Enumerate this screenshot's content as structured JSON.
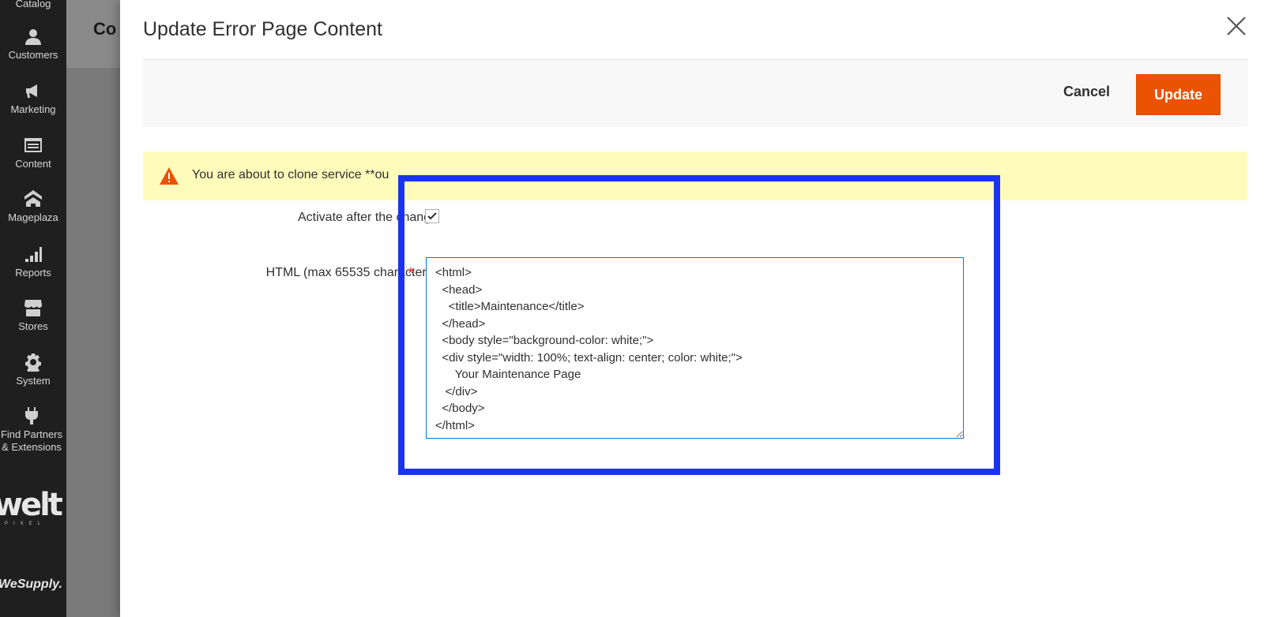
{
  "sidebar": {
    "items": [
      {
        "label": "Catalog",
        "icon": "catalog-icon"
      },
      {
        "label": "Customers",
        "icon": "customers-icon"
      },
      {
        "label": "Marketing",
        "icon": "megaphone-icon"
      },
      {
        "label": "Content",
        "icon": "content-icon"
      },
      {
        "label": "Mageplaza",
        "icon": "mageplaza-icon"
      },
      {
        "label": "Reports",
        "icon": "reports-icon"
      },
      {
        "label": "Stores",
        "icon": "stores-icon"
      },
      {
        "label": "System",
        "icon": "gear-icon"
      },
      {
        "label_line1": "Find Partners",
        "label_line2": "& Extensions",
        "icon": "plug-icon"
      }
    ],
    "brand_welt": "welt",
    "brand_pixel": "PIXEL",
    "brand_wesupply": "WeSupply."
  },
  "behind": {
    "title": "Co"
  },
  "modal": {
    "title": "Update Error Page Content",
    "cancel_label": "Cancel",
    "update_label": "Update",
    "warning_text": "You are about to clone service **ou",
    "activate_label": "Activate after the change",
    "activate_checked": true,
    "html_label": "HTML (max 65535 characters)",
    "required_mark": "*",
    "html_value": "<html>\n  <head>\n    <title>Maintenance</title>\n  </head>\n  <body style=\"background-color: white;\">\n  <div style=\"width: 100%; text-align: center; color: white;\">\n      Your Maintenance Page\n   </div>\n  </body>\n</html>"
  },
  "colors": {
    "accent": "#eb5202",
    "highlight": "#1a33f0",
    "warning_bg": "#fffbbb",
    "focus": "#007bdb"
  }
}
